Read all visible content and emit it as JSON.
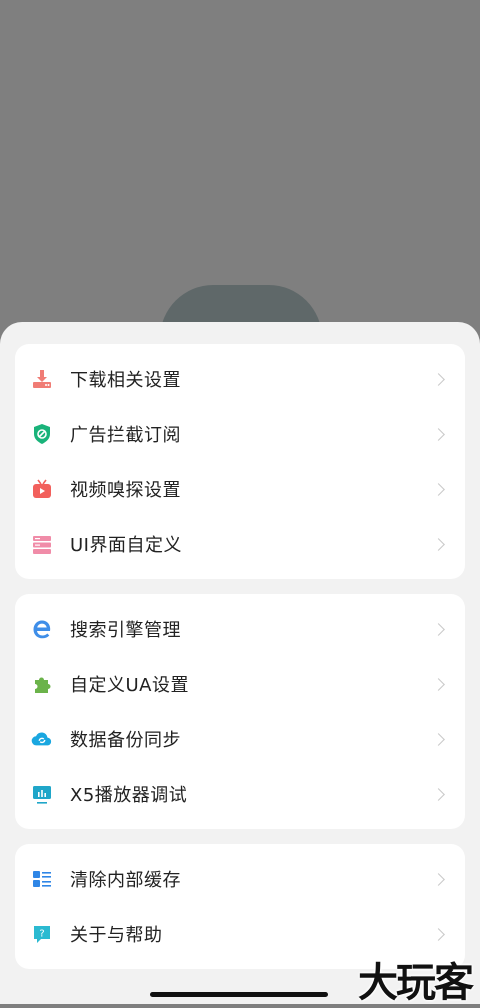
{
  "groups": [
    {
      "items": [
        {
          "label": "下载相关设置",
          "icon": "download-icon"
        },
        {
          "label": "广告拦截订阅",
          "icon": "shield-block-icon"
        },
        {
          "label": "视频嗅探设置",
          "icon": "tv-play-icon"
        },
        {
          "label": "UI界面自定义",
          "icon": "layout-stack-icon"
        }
      ]
    },
    {
      "items": [
        {
          "label": "搜索引擎管理",
          "icon": "browser-e-icon"
        },
        {
          "label": "自定义UA设置",
          "icon": "puzzle-icon"
        },
        {
          "label": "数据备份同步",
          "icon": "cloud-sync-icon"
        },
        {
          "label": "X5播放器调试",
          "icon": "monitor-chart-icon"
        }
      ]
    },
    {
      "items": [
        {
          "label": "清除内部缓存",
          "icon": "list-grid-icon"
        },
        {
          "label": "关于与帮助",
          "icon": "help-bubble-icon"
        }
      ]
    }
  ],
  "colors": {
    "download": "#f07c75",
    "shield": "#19b37a",
    "tv": "#f2605c",
    "layout": "#f08ca8",
    "browser": "#3f8ee8",
    "puzzle": "#6bb34a",
    "cloud": "#1aa7e0",
    "monitor": "#1fa6c9",
    "list": "#2f86e6",
    "help": "#2bbad1"
  },
  "watermark": "大玩客"
}
